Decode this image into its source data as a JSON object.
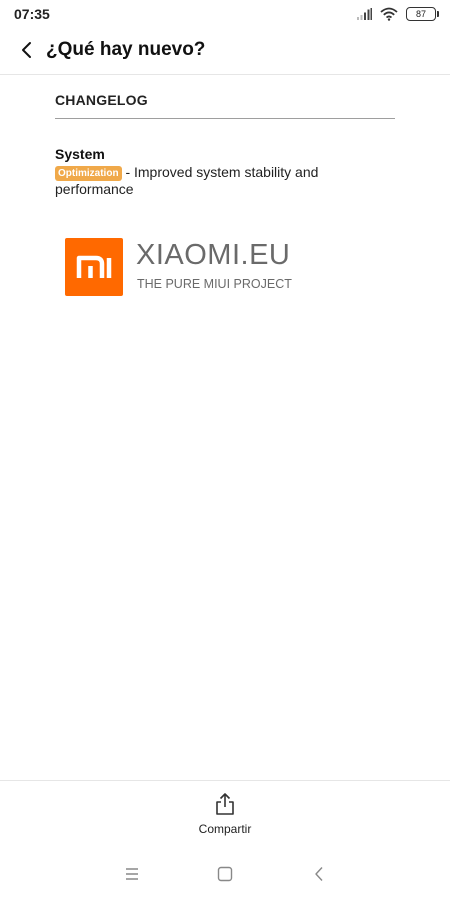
{
  "status_bar": {
    "time": "07:35",
    "battery_level": "87",
    "icons": [
      "signal-icon",
      "wifi-icon",
      "battery-icon"
    ]
  },
  "header": {
    "title": "¿Qué hay nuevo?",
    "back_icon": "back-arrow-icon"
  },
  "changelog": {
    "section_title": "CHANGELOG",
    "entries": [
      {
        "category": "System",
        "tag": "Optimization",
        "text": "- Improved system stability and",
        "text_continued": "performance"
      }
    ]
  },
  "logo": {
    "mark": "MI",
    "name": "XIAOMI.EU",
    "tagline": "THE PURE MIUI PROJECT"
  },
  "action_bar": {
    "share_label": "Compartir",
    "share_icon": "share-icon"
  },
  "nav_bar": {
    "icons": [
      "menu-icon",
      "home-icon",
      "back-icon"
    ]
  },
  "colors": {
    "tag_background": "#f0a94a",
    "logo_orange": "#ff6900",
    "logo_text": "#6a6a6a",
    "divider": "#9e9e9e"
  }
}
